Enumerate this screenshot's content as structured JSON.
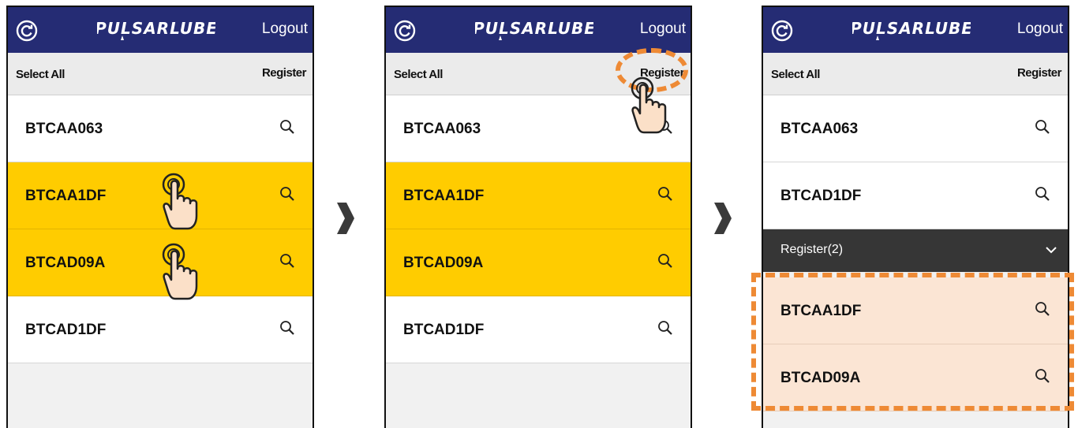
{
  "app": {
    "logout_label": "Logout",
    "select_all_label": "Select All",
    "register_label": "Register",
    "brand_color": "#252c74",
    "selected_color": "#ffcc00",
    "registered_color": "#fbe5d4",
    "highlight_color": "#ee8a35"
  },
  "screens": [
    {
      "items": [
        {
          "label": "BTCAA063",
          "state": "normal"
        },
        {
          "label": "BTCAA1DF",
          "state": "selected"
        },
        {
          "label": "BTCAD09A",
          "state": "selected"
        },
        {
          "label": "BTCAD1DF",
          "state": "normal"
        }
      ]
    },
    {
      "items": [
        {
          "label": "BTCAA063",
          "state": "normal"
        },
        {
          "label": "BTCAA1DF",
          "state": "selected"
        },
        {
          "label": "BTCAD09A",
          "state": "selected"
        },
        {
          "label": "BTCAD1DF",
          "state": "normal"
        }
      ]
    },
    {
      "items": [
        {
          "label": "BTCAA063",
          "state": "normal"
        },
        {
          "label": "BTCAD1DF",
          "state": "normal"
        }
      ],
      "register_group": {
        "header": "Register(2)",
        "items": [
          {
            "label": "BTCAA1DF",
            "state": "registered"
          },
          {
            "label": "BTCAD09A",
            "state": "registered"
          }
        ]
      }
    }
  ]
}
